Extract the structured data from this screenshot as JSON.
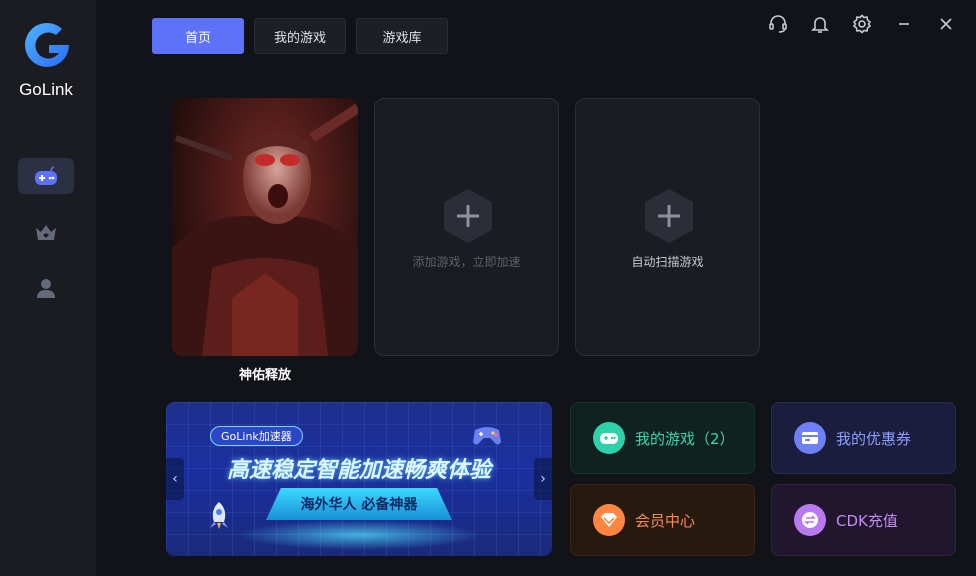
{
  "app": {
    "brand": "GoLink"
  },
  "tabs": [
    {
      "label": "首页",
      "active": true
    },
    {
      "label": "我的游戏",
      "active": false
    },
    {
      "label": "游戏库",
      "active": false
    }
  ],
  "sidebar": {
    "items": [
      {
        "icon": "gamepad-icon",
        "active": true
      },
      {
        "icon": "crown-icon",
        "active": false
      },
      {
        "icon": "user-icon",
        "active": false
      }
    ]
  },
  "window_controls": [
    "headset-icon",
    "bell-icon",
    "gear-icon",
    "minimize-icon",
    "close-icon"
  ],
  "games": {
    "card": {
      "name": "神佑释放"
    },
    "add_game": {
      "label": "添加游戏，立即加速"
    },
    "auto_scan": {
      "label": "自动扫描游戏"
    }
  },
  "banner": {
    "tag": "GoLink加速器",
    "headline": "高速稳定智能加速畅爽体验",
    "subline": "海外华人 必备神器",
    "prev": "‹",
    "next": "›"
  },
  "quick_links": {
    "my_games": "我的游戏（2）",
    "coupons": "我的优惠券",
    "vip": "会员中心",
    "cdk": "CDK充值"
  },
  "colors": {
    "accent": "#5d72f8",
    "my_games": "#35d7b0",
    "coupons": "#8e9eff",
    "vip": "#ff8a4c",
    "cdk": "#c38cf5"
  }
}
